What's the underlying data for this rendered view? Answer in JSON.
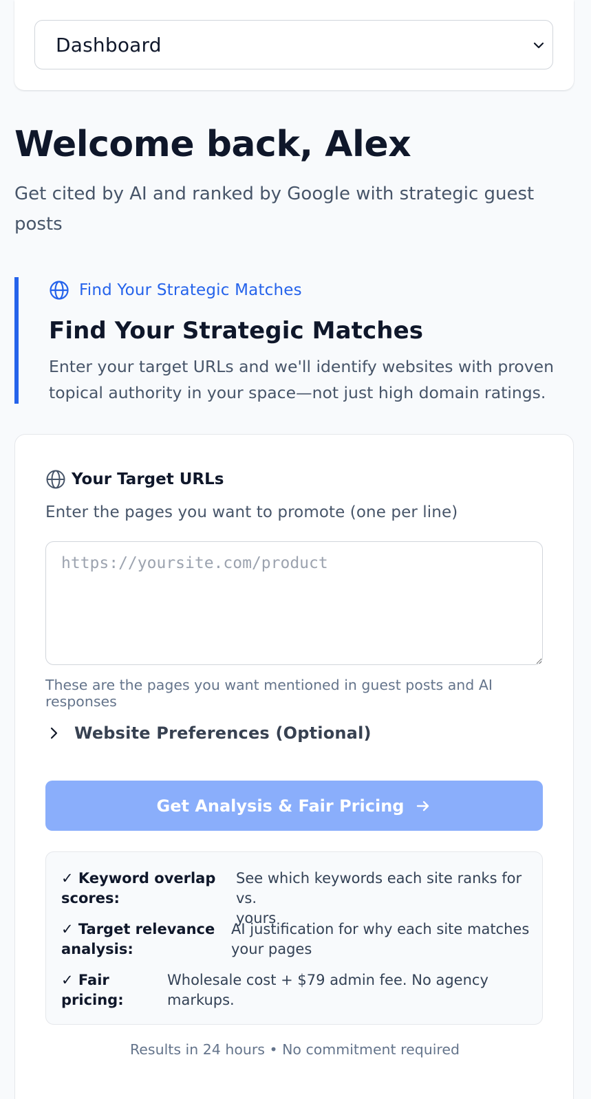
{
  "nav": {
    "selected": "Dashboard",
    "chevron_icon": "chevron-down-icon"
  },
  "welcome": {
    "title": "Welcome back, Alex",
    "subtitle": "Get cited by AI and ranked by Google with strategic guest posts"
  },
  "callout": {
    "eyebrow_icon": "globe-icon",
    "eyebrow": "Find Your Strategic Matches",
    "title": "Find Your Strategic Matches",
    "description": "Enter your target URLs and we'll identify websites with proven topical authority in your space—not just high domain ratings.",
    "accent_color": "#2563eb"
  },
  "form": {
    "label_icon": "globe-icon",
    "label": "Your Target URLs",
    "help": "Enter the pages you want to promote (one per line)",
    "textarea_value": "",
    "textarea_placeholder": "https://yoursite.com/product",
    "hint": "These are the pages you want mentioned in guest posts and AI responses",
    "preferences_label": "Website Preferences (Optional)",
    "preferences_icon": "chevron-right-icon",
    "submit_label": "Get Analysis & Fair Pricing",
    "submit_icon": "arrow-right-icon",
    "submit_color": "#8aaefb"
  },
  "benefits": [
    {
      "term_line1": "✓ Keyword overlap",
      "term_line2": "scores:",
      "desc_line1": "See which keywords each site ranks for vs.",
      "desc_line2": "yours"
    },
    {
      "term_line1": "✓ Target relevance",
      "term_line2": "analysis:",
      "desc_line1": "AI justification for why each site matches",
      "desc_line2": "your pages"
    },
    {
      "term_line1": "✓ Fair",
      "term_line2": "pricing:",
      "desc_line1": "Wholesale cost + $79 admin fee. No agency",
      "desc_line2": "markups."
    }
  ],
  "footnote": "Results in 24 hours • No commitment required"
}
